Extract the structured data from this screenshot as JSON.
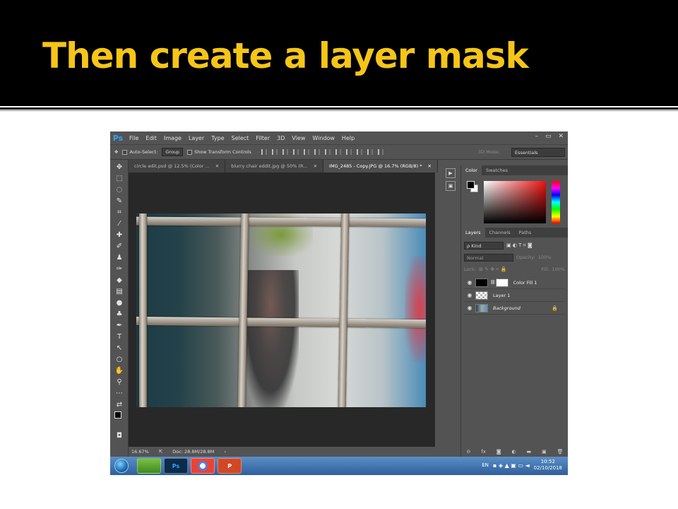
{
  "slide": {
    "title": "Then create a layer mask"
  },
  "app": {
    "logo": "Ps",
    "menu": [
      "File",
      "Edit",
      "Image",
      "Layer",
      "Type",
      "Select",
      "Filter",
      "3D",
      "View",
      "Window",
      "Help"
    ],
    "window_controls": [
      "–",
      "▭",
      "✕"
    ]
  },
  "options": {
    "auto_select_label": "Auto-Select:",
    "auto_select_value": "Group",
    "show_transform_label": "Show Transform Controls",
    "mode_3d_label": "3D Mode:",
    "workspace": "Essentials"
  },
  "tabs": [
    {
      "label": "circle edit.psd @ 12.5% (Color ...",
      "close": "✕"
    },
    {
      "label": "blurry chair eddit.jpg @ 50% (R...",
      "close": "✕"
    },
    {
      "label": "IMG_2485 - Copy.JPG @ 16.7% (RGB/8) *",
      "close": "✕"
    }
  ],
  "status": {
    "zoom": "16.67%",
    "doc": "Doc: 28.8M/28.8M",
    "arrow": "›"
  },
  "color_panel": {
    "tabs": [
      "Color",
      "Swatches"
    ]
  },
  "layers_panel": {
    "tabs": [
      "Layers",
      "Channels",
      "Paths"
    ],
    "kind_label": "ρ Kind",
    "blend_mode": "Normal",
    "opacity_label": "Opacity:",
    "opacity_value": "100%",
    "lock_label": "Lock:",
    "fill_label": "Fill:",
    "fill_value": "100%",
    "layers": [
      {
        "name": "Color Fill 1"
      },
      {
        "name": "Layer 1"
      },
      {
        "name": "Background",
        "lock": "🔒"
      }
    ],
    "footer_icons": [
      "⊝",
      "fx",
      "◙",
      "◐",
      "▬",
      "▣",
      "🗑"
    ]
  },
  "taskbar": {
    "apps": [
      "",
      "Ps",
      "",
      "P"
    ],
    "language": "EN",
    "time": "10:52",
    "date": "02/10/2018"
  }
}
